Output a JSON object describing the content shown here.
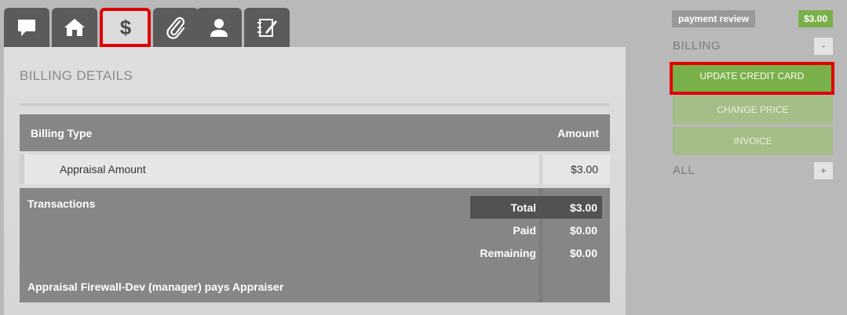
{
  "tabs": [
    {
      "icon": "chat-icon"
    },
    {
      "icon": "home-icon"
    },
    {
      "icon": "dollar-icon",
      "active": true
    },
    {
      "icon": "paperclip-icon"
    },
    {
      "icon": "user-icon"
    },
    {
      "icon": "notebook-pen-icon"
    }
  ],
  "panel": {
    "title": "BILLING DETAILS",
    "table": {
      "headers": [
        "Billing Type",
        "Amount"
      ],
      "rows": [
        {
          "type": "Appraisal Amount",
          "amount": "$3.00"
        }
      ]
    },
    "transactions": {
      "label": "Transactions",
      "summary": [
        {
          "label": "Total",
          "value": "$3.00"
        },
        {
          "label": "Paid",
          "value": "$0.00"
        },
        {
          "label": "Remaining",
          "value": "$0.00"
        }
      ],
      "note": "Appraisal Firewall-Dev (manager) pays Appraiser"
    }
  },
  "sidebar": {
    "status_badge": "payment review",
    "price_badge": "$3.00",
    "billing_section": {
      "label": "BILLING",
      "toggle": "-"
    },
    "buttons": [
      {
        "label": "UPDATE CREDIT CARD"
      },
      {
        "label": "CHANGE PRICE"
      },
      {
        "label": "INVOICE"
      }
    ],
    "all_section": {
      "label": "ALL",
      "toggle": "+"
    }
  },
  "colors": {
    "background": "#b9b9b9",
    "tab_bg": "#5b5b5b",
    "accent_green": "#7ab04a",
    "muted_green": "#a3be86",
    "highlight_red": "#e00000",
    "table_header": "#868686"
  }
}
